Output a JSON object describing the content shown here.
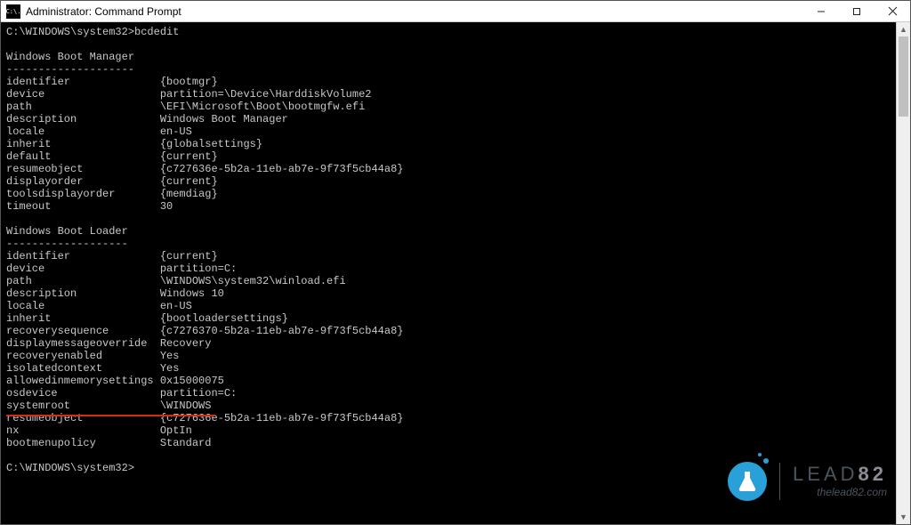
{
  "window": {
    "title": "Administrator: Command Prompt",
    "icon_text": "C:\\."
  },
  "prompt": "C:\\WINDOWS\\system32>",
  "command": "bcdedit",
  "sections": [
    {
      "title": "Windows Boot Manager",
      "rows": [
        {
          "k": "identifier",
          "v": "{bootmgr}"
        },
        {
          "k": "device",
          "v": "partition=\\Device\\HarddiskVolume2"
        },
        {
          "k": "path",
          "v": "\\EFI\\Microsoft\\Boot\\bootmgfw.efi"
        },
        {
          "k": "description",
          "v": "Windows Boot Manager"
        },
        {
          "k": "locale",
          "v": "en-US"
        },
        {
          "k": "inherit",
          "v": "{globalsettings}"
        },
        {
          "k": "default",
          "v": "{current}"
        },
        {
          "k": "resumeobject",
          "v": "{c727636e-5b2a-11eb-ab7e-9f73f5cb44a8}"
        },
        {
          "k": "displayorder",
          "v": "{current}"
        },
        {
          "k": "toolsdisplayorder",
          "v": "{memdiag}"
        },
        {
          "k": "timeout",
          "v": "30"
        }
      ]
    },
    {
      "title": "Windows Boot Loader",
      "rows": [
        {
          "k": "identifier",
          "v": "{current}"
        },
        {
          "k": "device",
          "v": "partition=C:"
        },
        {
          "k": "path",
          "v": "\\WINDOWS\\system32\\winload.efi"
        },
        {
          "k": "description",
          "v": "Windows 10"
        },
        {
          "k": "locale",
          "v": "en-US"
        },
        {
          "k": "inherit",
          "v": "{bootloadersettings}"
        },
        {
          "k": "recoverysequence",
          "v": "{c7276370-5b2a-11eb-ab7e-9f73f5cb44a8}"
        },
        {
          "k": "displaymessageoverride",
          "v": "Recovery"
        },
        {
          "k": "recoveryenabled",
          "v": "Yes"
        },
        {
          "k": "isolatedcontext",
          "v": "Yes"
        },
        {
          "k": "allowedinmemorysettings",
          "v": "0x15000075"
        },
        {
          "k": "osdevice",
          "v": "partition=C:"
        },
        {
          "k": "systemroot",
          "v": "\\WINDOWS"
        },
        {
          "k": "resumeobject",
          "v": "{c727636e-5b2a-11eb-ab7e-9f73f5cb44a8}"
        },
        {
          "k": "nx",
          "v": "OptIn"
        },
        {
          "k": "bootmenupolicy",
          "v": "Standard"
        }
      ]
    }
  ],
  "trailing_prompt": "C:\\WINDOWS\\system32>",
  "watermark": {
    "brand_prefix": "LEAD",
    "brand_suffix": "82",
    "url": "thelead82.com"
  }
}
